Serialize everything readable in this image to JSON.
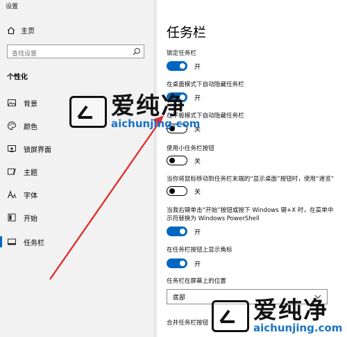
{
  "window": {
    "title": "设置"
  },
  "sidebar": {
    "home_label": "主页",
    "search_placeholder": "查找设置",
    "section": "个性化",
    "items": [
      {
        "label": "背景",
        "icon": "image-icon"
      },
      {
        "label": "颜色",
        "icon": "palette-icon"
      },
      {
        "label": "锁屏界面",
        "icon": "lock-screen-icon"
      },
      {
        "label": "主题",
        "icon": "theme-icon"
      },
      {
        "label": "字体",
        "icon": "font-icon"
      },
      {
        "label": "开始",
        "icon": "start-icon"
      },
      {
        "label": "任务栏",
        "icon": "taskbar-icon",
        "active": true
      }
    ]
  },
  "main": {
    "title": "任务栏",
    "settings": [
      {
        "label": "锁定任务栏",
        "state": "开",
        "on": true
      },
      {
        "label": "在桌面模式下自动隐藏任务栏",
        "state": "开",
        "on": true
      },
      {
        "label": "在平板模式下自动隐藏任务栏",
        "state": "关",
        "on": false
      },
      {
        "label": "使用小任务栏按钮",
        "state": "关",
        "on": false
      },
      {
        "label": "当你将鼠标移动到任务栏末端的“显示桌面”按钮时，使用“速览”",
        "state": "关",
        "on": false
      },
      {
        "label_line1": "当我右键单击“开始”按钮或按下 Windows 键+X 时，在菜单中",
        "label_line2": "示符替换为 Windows PowerShell",
        "state": "开",
        "on": true
      },
      {
        "label": "在任务栏按钮上显示角标",
        "state": "开",
        "on": true
      }
    ],
    "position_label": "任务栏在屏幕上的位置",
    "position_value": "底部",
    "combine_label": "合并任务栏按钮"
  },
  "watermark": {
    "name": "爱纯净",
    "url": "aichunjing.com"
  },
  "colors": {
    "accent": "#0067c0",
    "arrow": "#e03030",
    "url": "#1a73c9"
  }
}
